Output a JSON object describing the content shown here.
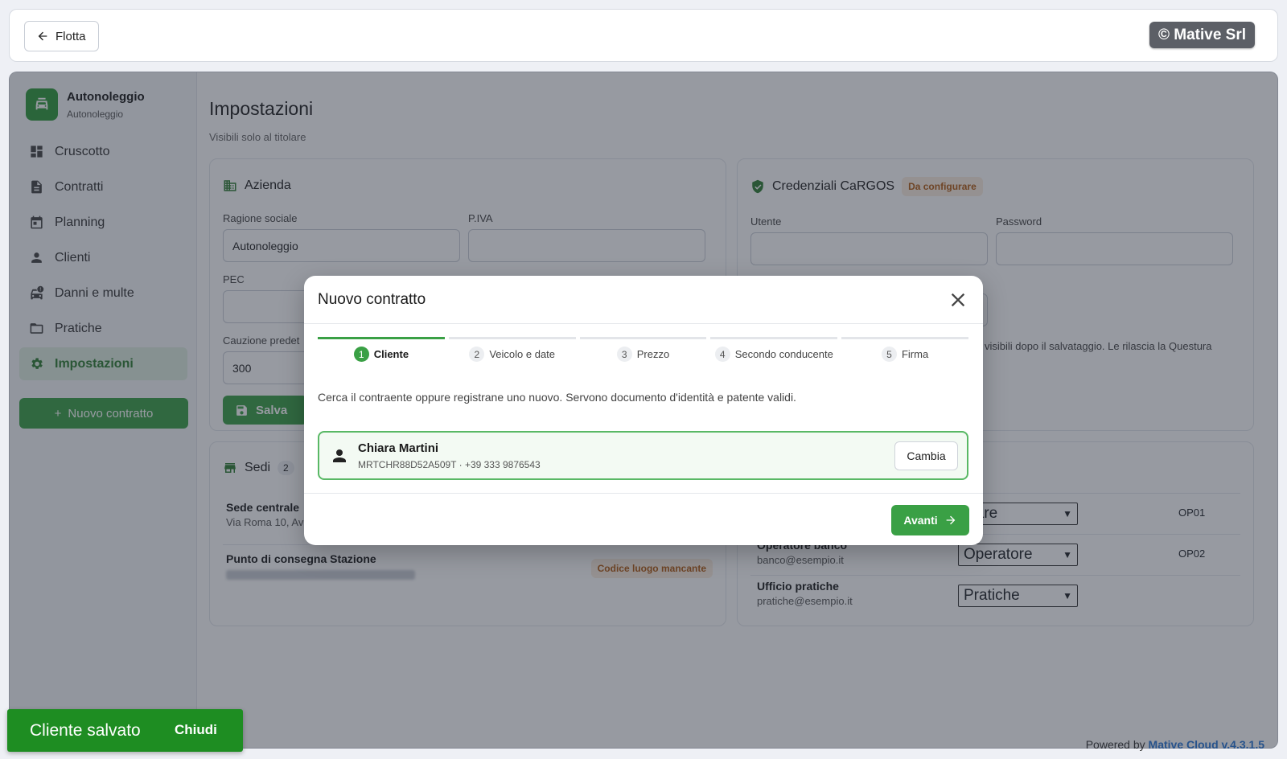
{
  "topbar": {
    "back_label": "Flotta",
    "brand": "© Mative Srl"
  },
  "sidebar": {
    "org_name": "Autonoleggio",
    "org_sub": "Autonoleggio",
    "items": [
      {
        "label": "Cruscotto",
        "icon": "dashboard-icon"
      },
      {
        "label": "Contratti",
        "icon": "document-icon"
      },
      {
        "label": "Planning",
        "icon": "calendar-icon"
      },
      {
        "label": "Clienti",
        "icon": "person-icon"
      },
      {
        "label": "Danni e multe",
        "icon": "car-damage-icon"
      },
      {
        "label": "Pratiche",
        "icon": "folder-icon"
      },
      {
        "label": "Impostazioni",
        "icon": "gear-icon",
        "active": true
      }
    ],
    "new_contract_label": "Nuovo contratto"
  },
  "page": {
    "title": "Impostazioni",
    "subtitle": "Visibili solo al titolare"
  },
  "azienda": {
    "title": "Azienda",
    "ragione_label": "Ragione sociale",
    "ragione_value": "Autonoleggio",
    "piva_label": "P.IVA",
    "piva_value": "",
    "pec_label": "PEC",
    "cauzione_label": "Cauzione predet",
    "cauzione_value": "300",
    "save_label": "Salva"
  },
  "cargos": {
    "title": "Credenziali CaRGOS",
    "status": "Da configurare",
    "utente_label": "Utente",
    "password_label": "Password",
    "note": "più visibili dopo il salvataggio. Le rilascia la Questura"
  },
  "sedi": {
    "title": "Sedi",
    "count": "2",
    "rows": [
      {
        "name": "Sede centrale",
        "address": "Via Roma 10, Av"
      },
      {
        "name": "Punto di consegna Stazione",
        "address": "",
        "badge": "Codice luogo mancante"
      }
    ]
  },
  "operatori": {
    "rows": [
      {
        "name": "",
        "email": "",
        "role": "olare",
        "code": "OP01"
      },
      {
        "name": "Operatore banco",
        "email": "banco@esempio.it",
        "role": "Operatore",
        "code": "OP02"
      },
      {
        "name": "Ufficio pratiche",
        "email": "pratiche@esempio.it",
        "role": "Pratiche",
        "code": ""
      }
    ]
  },
  "modal": {
    "title": "Nuovo contratto",
    "steps": [
      {
        "num": "1",
        "label": "Cliente",
        "active": true
      },
      {
        "num": "2",
        "label": "Veicolo e date"
      },
      {
        "num": "3",
        "label": "Prezzo"
      },
      {
        "num": "4",
        "label": "Secondo conducente"
      },
      {
        "num": "5",
        "label": "Firma"
      }
    ],
    "description": "Cerca il contraente oppure registrane uno nuovo. Servono documento d'identità e patente validi.",
    "client_name": "Chiara Martini",
    "client_detail": "MRTCHR88D52A509T · +39 333 9876543",
    "change_label": "Cambia",
    "next_label": "Avanti"
  },
  "toast": {
    "message": "Cliente salvato",
    "close_label": "Chiudi"
  },
  "footer": {
    "powered_prefix": "Powered by",
    "powered_brand": "Mative Cloud v.4.3.1.5"
  },
  "colors": {
    "accent": "#3aa045",
    "toast": "#1e8d22",
    "warning": "#b15a12",
    "link": "#2a77d6"
  }
}
